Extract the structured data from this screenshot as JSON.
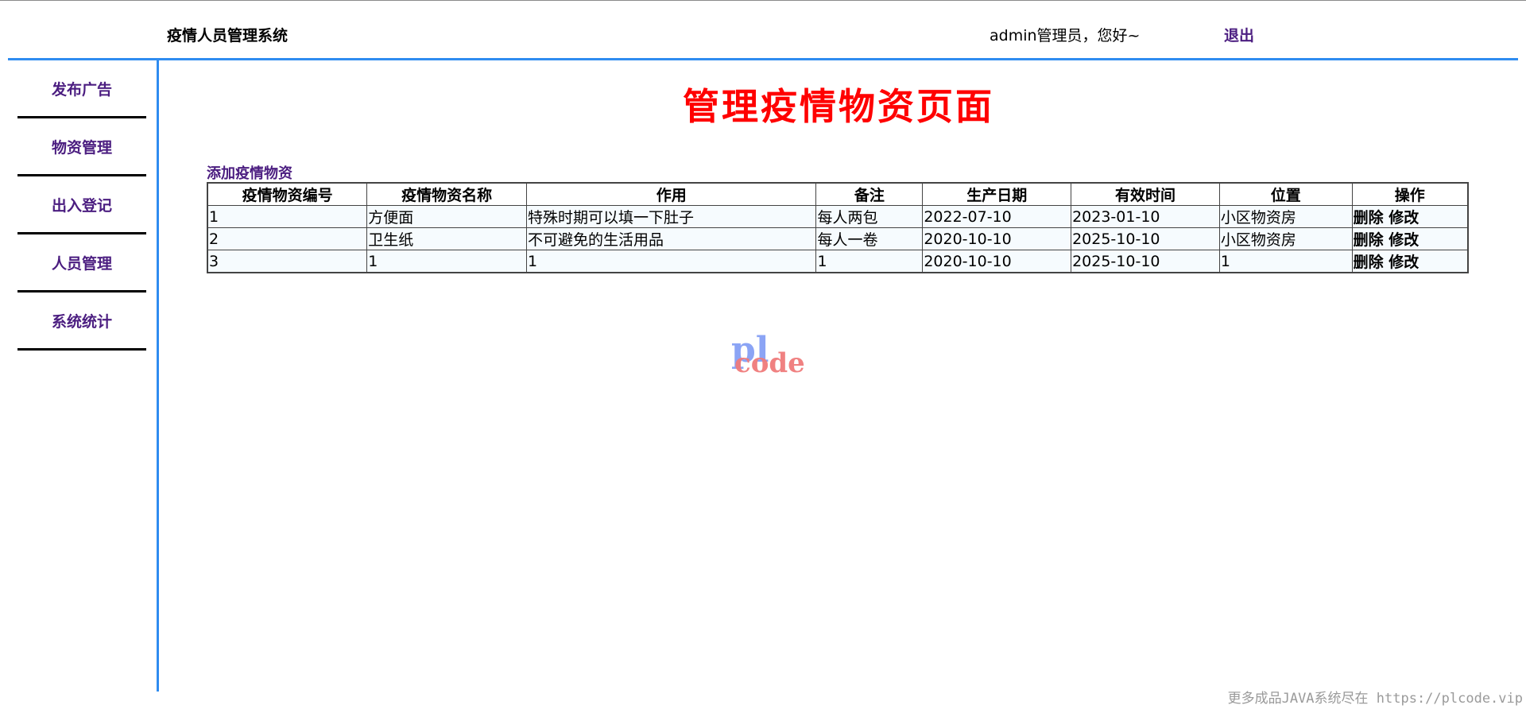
{
  "header": {
    "app_title": "疫情人员管理系统",
    "greeting": "admin管理员，您好~",
    "logout_label": "退出"
  },
  "sidebar": {
    "items": [
      {
        "label": "发布广告"
      },
      {
        "label": "物资管理"
      },
      {
        "label": "出入登记"
      },
      {
        "label": "人员管理"
      },
      {
        "label": "系统统计"
      }
    ]
  },
  "main": {
    "heading": "管理疫情物资页面",
    "add_link": "添加疫情物资",
    "table": {
      "columns": [
        "疫情物资编号",
        "疫情物资名称",
        "作用",
        "备注",
        "生产日期",
        "有效时间",
        "位置",
        "操作"
      ],
      "rows": [
        {
          "id": "1",
          "name": "方便面",
          "purpose": "特殊时期可以填一下肚子",
          "note": "每人两包",
          "production_date": "2022-07-10",
          "valid_until": "2023-01-10",
          "location": "小区物资房"
        },
        {
          "id": "2",
          "name": "卫生纸",
          "purpose": "不可避免的生活用品",
          "note": "每人一卷",
          "production_date": "2020-10-10",
          "valid_until": "2025-10-10",
          "location": "小区物资房"
        },
        {
          "id": "3",
          "name": "1",
          "purpose": "1",
          "note": "1",
          "production_date": "2020-10-10",
          "valid_until": "2025-10-10",
          "location": "1"
        }
      ],
      "delete_label": "删除",
      "edit_label": "修改"
    }
  },
  "watermark": {
    "logo_top": "pl",
    "logo_bottom": "code",
    "footer_text": "更多成品JAVA系统尽在 https://plcode.vip"
  },
  "colors": {
    "accent_blue": "#2f8cf0",
    "link_purple": "#4b1d80",
    "heading_red": "#ff0000",
    "row_bg": "#f6fbfe"
  }
}
